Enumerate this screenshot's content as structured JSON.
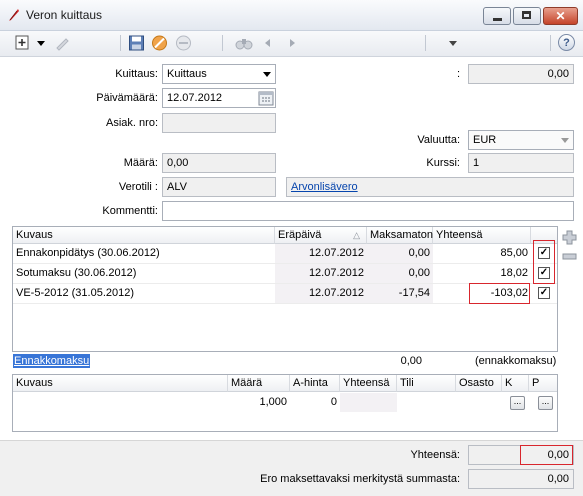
{
  "window": {
    "title": "Veron kuittaus"
  },
  "toolbar": {
    "help": "?"
  },
  "form": {
    "kuittaus_label": "Kuittaus:",
    "kuittaus_value": "Kuittaus",
    "colon_label": ":",
    "top_amount": "0,00",
    "paivamaara_label": "Päivämäärä:",
    "paivamaara_value": "12.07.2012",
    "asiak_label": "Asiak. nro:",
    "asiak_value": "",
    "valuutta_label": "Valuutta:",
    "valuutta_value": "EUR",
    "maara_label": "Määrä:",
    "maara_value": "0,00",
    "kurssi_label": "Kurssi:",
    "kurssi_value": "1",
    "verotili_label": "Verotili :",
    "verotili_value": "ALV",
    "verotili_link": "Arvonlisävero",
    "kommentti_label": "Kommentti:",
    "kommentti_value": ""
  },
  "tax_table": {
    "columns": [
      "Kuvaus",
      "Eräpäivä",
      "Maksamaton",
      "Yhteensä"
    ],
    "sort_indicator": "△",
    "rows": [
      {
        "kuvaus": "Ennakonpidätys (30.06.2012)",
        "erapaiva": "12.07.2012",
        "maksamaton": "0,00",
        "yhteensa": "85,00",
        "checked": "✓"
      },
      {
        "kuvaus": "Sotumaksu (30.06.2012)",
        "erapaiva": "12.07.2012",
        "maksamaton": "0,00",
        "yhteensa": "18,02",
        "checked": "✓"
      },
      {
        "kuvaus": "VE-5-2012 (31.05.2012)",
        "erapaiva": "12.07.2012",
        "maksamaton": "-17,54",
        "yhteensa": "-103,02",
        "checked": "✓"
      }
    ]
  },
  "side_buttons": {
    "add": "plus-icon",
    "remove": "minus-icon"
  },
  "ennakko": {
    "label": "Ennakkomaksu",
    "value": "0,00",
    "note": "(ennakkomaksu)"
  },
  "entry_table": {
    "columns": [
      "Kuvaus",
      "Määrä",
      "A-hinta",
      "Yhteensä",
      "Tili",
      "Osasto",
      "K",
      "P"
    ],
    "row": {
      "kuvaus": "",
      "maara": "1,000",
      "ahinta": "0",
      "yhteensa": "",
      "tili": "",
      "osasto": "",
      "k": "...",
      "p": "..."
    }
  },
  "footer": {
    "yhteensa_label": "Yhteensä:",
    "yhteensa_value": "0,00",
    "ero_label": "Ero maksettavaksi merkitystä summasta:",
    "ero_value": "0,00"
  },
  "colors": {
    "highlight_red": "#d8262d",
    "link_blue": "#0645ad",
    "selection_blue": "#3875d7"
  }
}
